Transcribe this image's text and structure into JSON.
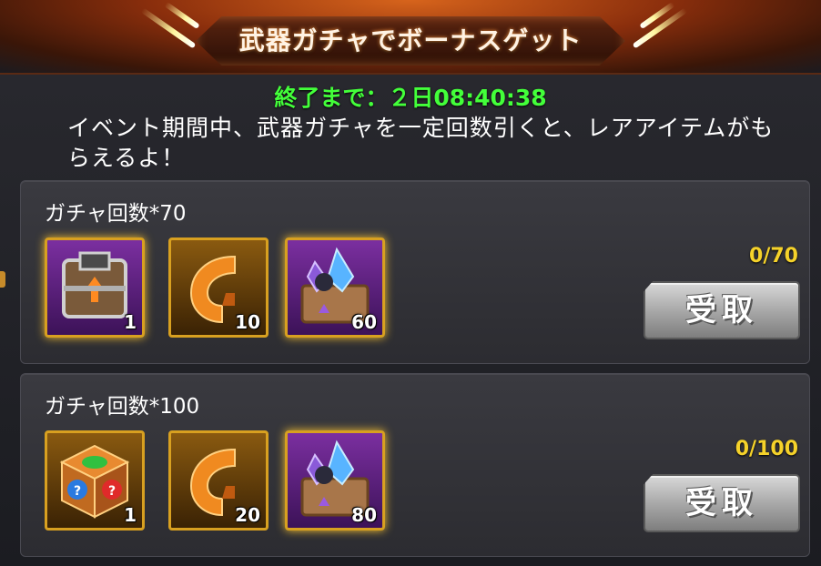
{
  "banner": {
    "title": "武器ガチャでボーナスゲット"
  },
  "timer": {
    "text": "終了まで：２日08:40:38"
  },
  "description": "イベント期間中、武器ガチャを一定回数引くと、レアアイテムがもらえるよ！",
  "tiers": [
    {
      "label": "ガチャ回数*70",
      "progress": "0/70",
      "claim_label": "受取",
      "items": [
        {
          "icon": "armor-box-icon",
          "count": "1",
          "frame": "purple"
        },
        {
          "icon": "weapon-fragment-icon",
          "count": "10",
          "frame": "gold"
        },
        {
          "icon": "crystal-chest-icon",
          "count": "60",
          "frame": "purple"
        }
      ]
    },
    {
      "label": "ガチャ回数*100",
      "progress": "0/100",
      "claim_label": "受取",
      "items": [
        {
          "icon": "mystery-cube-icon",
          "count": "1",
          "frame": "gold"
        },
        {
          "icon": "weapon-fragment-icon",
          "count": "20",
          "frame": "gold"
        },
        {
          "icon": "crystal-chest-icon",
          "count": "80",
          "frame": "purple"
        }
      ]
    }
  ],
  "colors": {
    "timer": "#43ff3a",
    "progress": "#f5d22a",
    "banner": "#d7641c"
  }
}
